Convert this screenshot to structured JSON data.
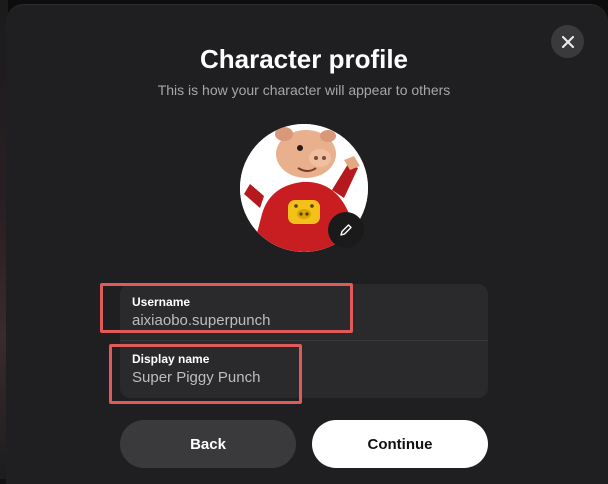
{
  "dialog": {
    "title": "Character profile",
    "subtitle": "This is how your character will appear to others"
  },
  "avatar": {
    "icon": "pig-character-avatar",
    "edit_icon": "pencil-icon"
  },
  "fields": {
    "username": {
      "label": "Username",
      "value": "aixiaobo.superpunch"
    },
    "display_name": {
      "label": "Display name",
      "value": "Super Piggy Punch"
    }
  },
  "buttons": {
    "back_label": "Back",
    "continue_label": "Continue"
  },
  "colors": {
    "modal_bg": "#1f1f21",
    "field_bg": "#2a2a2c",
    "highlight": "#e05a5a",
    "primary_btn": "#ffffff",
    "secondary_btn": "#3a3a3d"
  }
}
